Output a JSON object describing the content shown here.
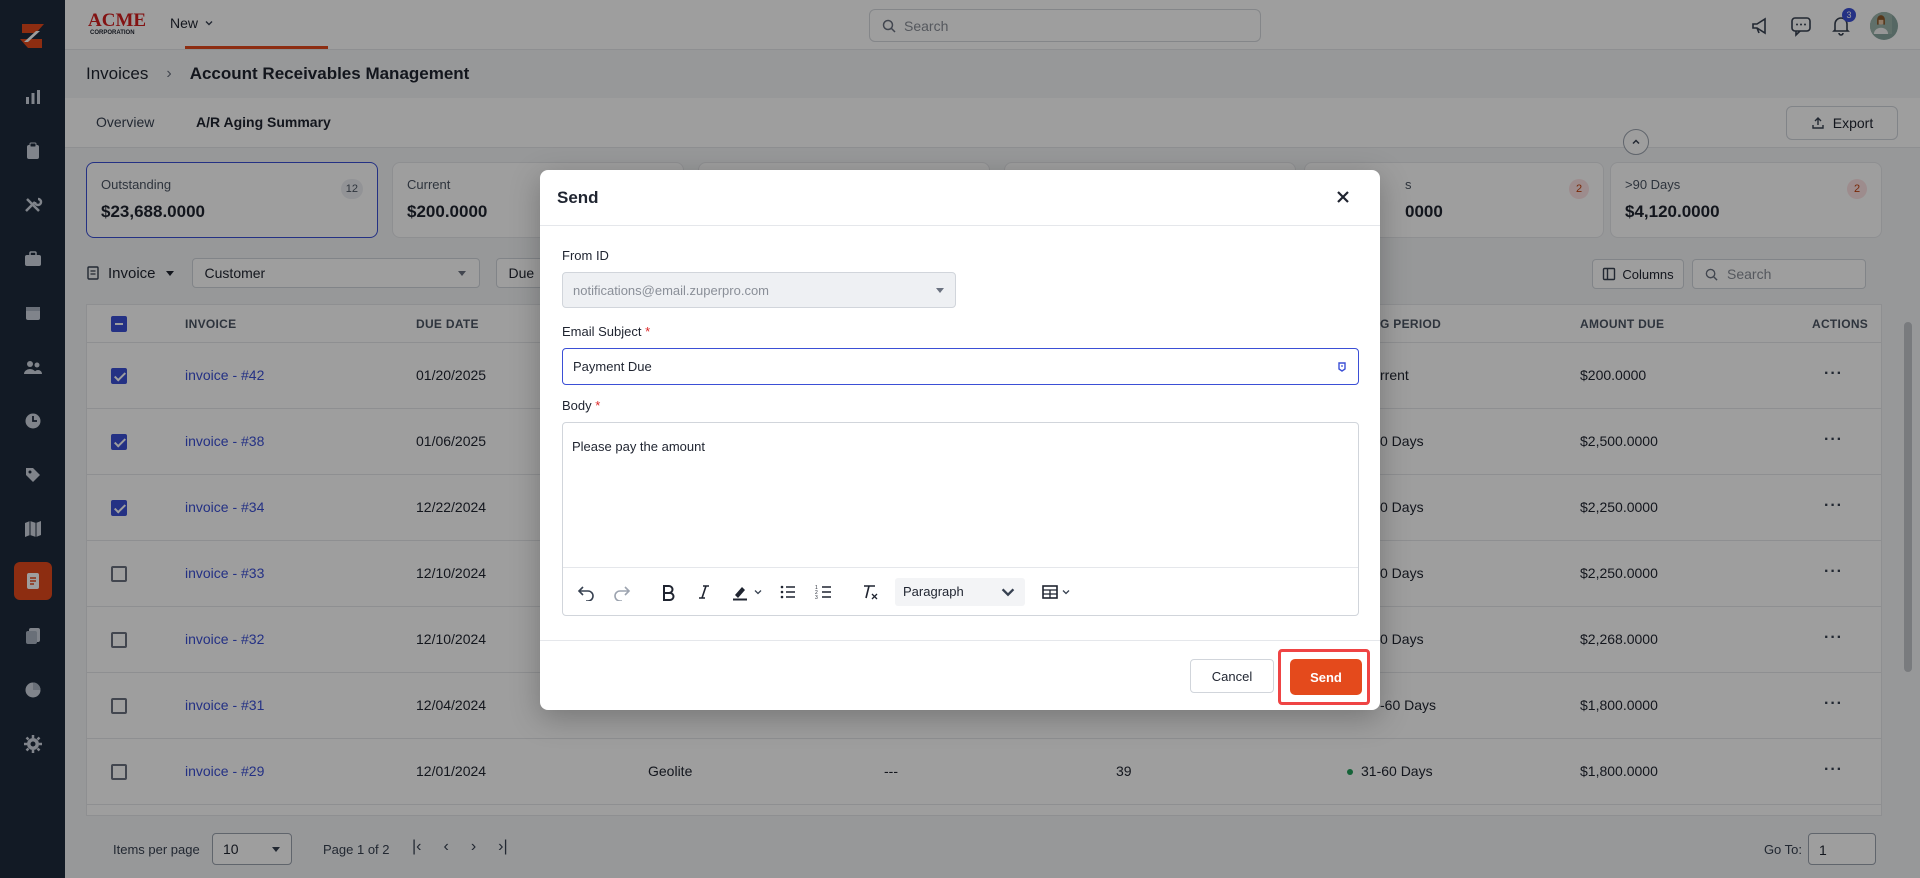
{
  "topbar": {
    "brand": "ACME CORPORATION",
    "new_label": "New",
    "search_placeholder": "Search",
    "notification_count": "3"
  },
  "breadcrumb": {
    "root": "Invoices",
    "current": "Account Receivables Management"
  },
  "tabs": [
    {
      "label": "Overview"
    },
    {
      "label": "A/R Aging Summary"
    }
  ],
  "export_label": "Export",
  "cards": [
    {
      "label": "Outstanding",
      "value": "$23,688.0000",
      "count": "12"
    },
    {
      "label": "Current",
      "value": "$200.0000",
      "count": ""
    },
    {
      "label": "",
      "value": "",
      "count": ""
    },
    {
      "label": "",
      "value": "",
      "count": ""
    },
    {
      "label": "s",
      "value": "0000",
      "count": "2"
    },
    {
      "label": ">90 Days",
      "value": "$4,120.0000",
      "count": "2"
    }
  ],
  "filters": {
    "invoice_label": "Invoice",
    "customer_label": "Customer",
    "due_label": "Due",
    "columns_label": "Columns",
    "search_placeholder": "Search"
  },
  "table": {
    "headers": {
      "invoice": "INVOICE",
      "due_date": "DUE DATE",
      "aging": "G PERIOD",
      "amount_due": "AMOUNT DUE",
      "actions": "ACTIONS"
    },
    "rows": [
      {
        "invoice": "invoice - #42",
        "due_date": "01/20/2025",
        "customer": "",
        "c4": "",
        "c5": "",
        "aging": "rrent",
        "amount": "$200.0000",
        "checked": true
      },
      {
        "invoice": "invoice - #38",
        "due_date": "01/06/2025",
        "customer": "",
        "c4": "",
        "c5": "",
        "aging": "0 Days",
        "amount": "$2,500.0000",
        "checked": true
      },
      {
        "invoice": "invoice - #34",
        "due_date": "12/22/2024",
        "customer": "",
        "c4": "",
        "c5": "",
        "aging": "0 Days",
        "amount": "$2,250.0000",
        "checked": true
      },
      {
        "invoice": "invoice - #33",
        "due_date": "12/10/2024",
        "customer": "",
        "c4": "",
        "c5": "",
        "aging": "0 Days",
        "amount": "$2,250.0000",
        "checked": false
      },
      {
        "invoice": "invoice - #32",
        "due_date": "12/10/2024",
        "customer": "",
        "c4": "",
        "c5": "",
        "aging": "0 Days",
        "amount": "$2,268.0000",
        "checked": false
      },
      {
        "invoice": "invoice - #31",
        "due_date": "12/04/2024",
        "customer": "",
        "c4": "",
        "c5": "",
        "aging": "-60 Days",
        "amount": "$1,800.0000",
        "checked": false
      },
      {
        "invoice": "invoice - #29",
        "due_date": "12/01/2024",
        "customer": "Geolite",
        "c4": "---",
        "c5": "39",
        "aging": "31-60 Days",
        "amount": "$1,800.0000",
        "checked": false
      }
    ]
  },
  "footer": {
    "items_label": "Items per page",
    "items_value": "10",
    "page_label": "Page 1 of 2",
    "goto_label": "Go To:",
    "goto_value": "1"
  },
  "modal": {
    "title": "Send",
    "from_label": "From ID",
    "from_value": "notifications@email.zuperpro.com",
    "subject_label": "Email Subject",
    "subject_value": "Payment Due",
    "body_label": "Body",
    "body_value": "Please pay the amount",
    "paragraph_label": "Paragraph",
    "cancel_label": "Cancel",
    "send_label": "Send",
    "required_mark": "*"
  },
  "colors": {
    "accent": "#e44a1c",
    "primary": "#3b4fd6",
    "sidebar": "#1e2b3c"
  }
}
